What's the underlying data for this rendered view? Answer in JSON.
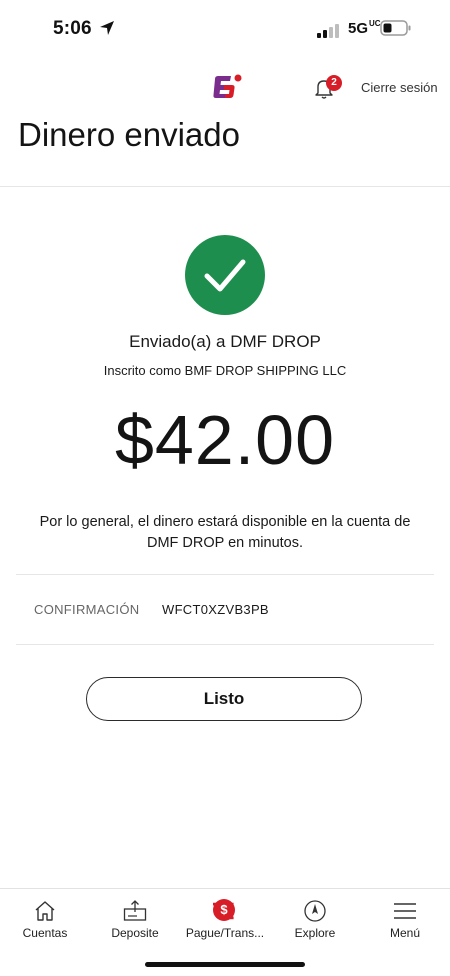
{
  "status_bar": {
    "time": "5:06",
    "network": "5G",
    "network_sup": "UC"
  },
  "header": {
    "notification_count": "2",
    "signout_label": "Cierre sesión",
    "brand_color": "#7b2d8e",
    "accent_color": "#d71e28"
  },
  "page": {
    "title": "Dinero enviado"
  },
  "confirmation_screen": {
    "sent_to": "Enviado(a) a DMF DROP",
    "enrolled_as": "Inscrito como BMF DROP SHIPPING LLC",
    "amount": "$42.00",
    "availability_line1": "Por lo general, el dinero estará disponible en la cuenta de",
    "availability_line2": "DMF DROP en minutos.",
    "confirmation_label": "CONFIRMACIÓN",
    "confirmation_number": "WFCT0XZVB3PB",
    "done_label": "Listo",
    "success_color": "#1e8e4e"
  },
  "tabbar": {
    "tabs": [
      {
        "label": "Cuentas",
        "icon": "home-icon"
      },
      {
        "label": "Deposite",
        "icon": "deposit-icon"
      },
      {
        "label": "Pague/Trans...",
        "icon": "pay-transfer-icon",
        "badge": "$"
      },
      {
        "label": "Explore",
        "icon": "compass-icon"
      },
      {
        "label": "Menú",
        "icon": "hamburger-menu-icon"
      }
    ]
  }
}
